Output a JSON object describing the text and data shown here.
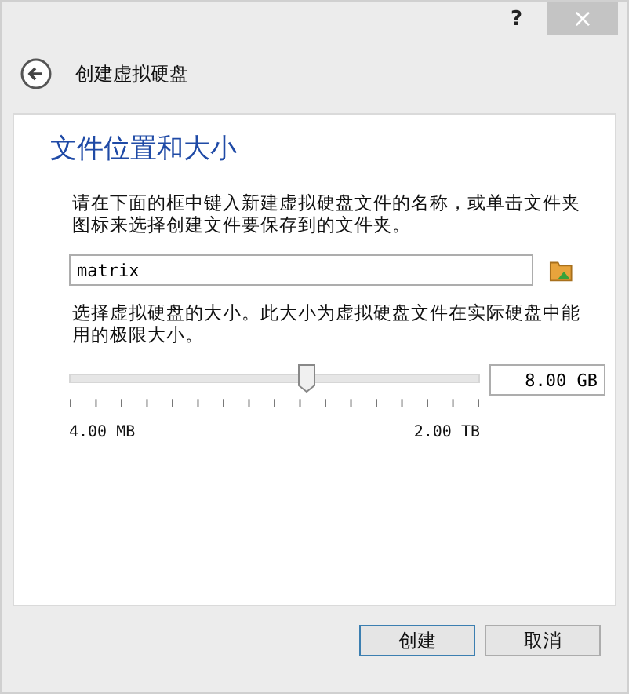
{
  "title_bar": {
    "help": "?",
    "close": "×"
  },
  "header": {
    "title": "创建虚拟硬盘"
  },
  "section_title": "文件位置和大小",
  "location": {
    "description": "请在下面的框中键入新建虚拟硬盘文件的名称，或单击文件夹图标来选择创建文件要保存到的文件夹。",
    "value": "matrix"
  },
  "size": {
    "description": "选择虚拟硬盘的大小。此大小为虚拟硬盘文件在实际硬盘中能用的极限大小。",
    "level": 0.575,
    "value": "8.00 GB",
    "min_label": "4.00 MB",
    "max_label": "2.00 TB"
  },
  "buttons": [
    {
      "label": "创建",
      "default": true
    },
    {
      "label": "取消",
      "default": false
    }
  ]
}
